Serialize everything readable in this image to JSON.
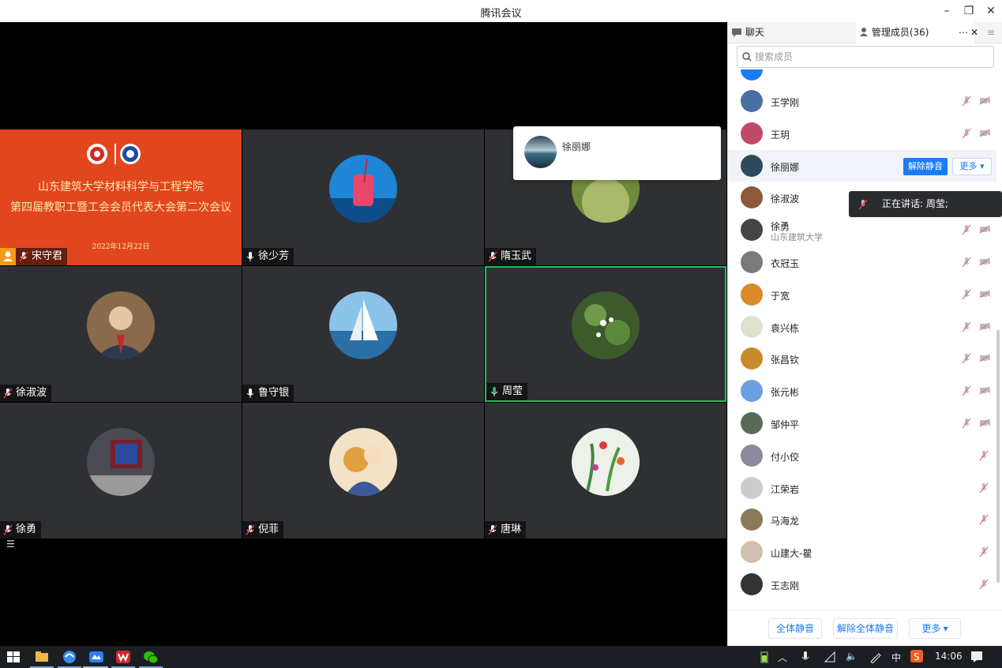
{
  "window": {
    "title": "腾讯会议"
  },
  "banner": {
    "line1": "山东建筑大学材料科学与工程学院",
    "line2": "第四届教职工暨工会会员代表大会第二次会议",
    "date": "2022年12月22日"
  },
  "tiles": [
    {
      "name": "宋守君",
      "mic": "muted",
      "host": true
    },
    {
      "name": "徐少芳",
      "mic": "on"
    },
    {
      "name": "隋玉武",
      "mic": "muted"
    },
    {
      "name": "徐淑波",
      "mic": "muted"
    },
    {
      "name": "鲁守银",
      "mic": "on"
    },
    {
      "name": "周莹",
      "mic": "on",
      "active": true
    },
    {
      "name": "徐勇",
      "mic": "muted"
    },
    {
      "name": "倪菲",
      "mic": "muted"
    },
    {
      "name": "唐琳",
      "mic": "muted"
    }
  ],
  "popup": {
    "name": "徐丽娜"
  },
  "panel": {
    "tab_chat": "聊天",
    "tab_members": "管理成员(36)",
    "search_placeholder": "搜索成员",
    "unmute_label": "解除静音",
    "more_label": "更多 ▾",
    "speaking_label": "正在讲话: 周莹;",
    "members": [
      {
        "name": "王学刚"
      },
      {
        "name": "王玥"
      },
      {
        "name": "徐丽娜",
        "highlight": true
      },
      {
        "name": "徐淑波"
      },
      {
        "name": "徐勇",
        "sub": "山东建筑大学"
      },
      {
        "name": "衣冠玉"
      },
      {
        "name": "于宽"
      },
      {
        "name": "袁兴栋"
      },
      {
        "name": "张昌钦"
      },
      {
        "name": "张元彬"
      },
      {
        "name": "邹仲平"
      },
      {
        "name": "付小佼"
      },
      {
        "name": "江荣岩"
      },
      {
        "name": "马海龙"
      },
      {
        "name": "山建大-瞿"
      },
      {
        "name": "王志刚"
      }
    ],
    "footer": {
      "mute_all": "全体静音",
      "unmute_all": "解除全体静音",
      "more": "更多 ▾"
    }
  },
  "taskbar": {
    "ime": "中",
    "clock": "14:06"
  },
  "colors": {
    "accent": "#1a7cf5",
    "active_border": "#1fbe5c",
    "banner_bg": "#e2461f",
    "host_badge": "#f39b1b"
  }
}
